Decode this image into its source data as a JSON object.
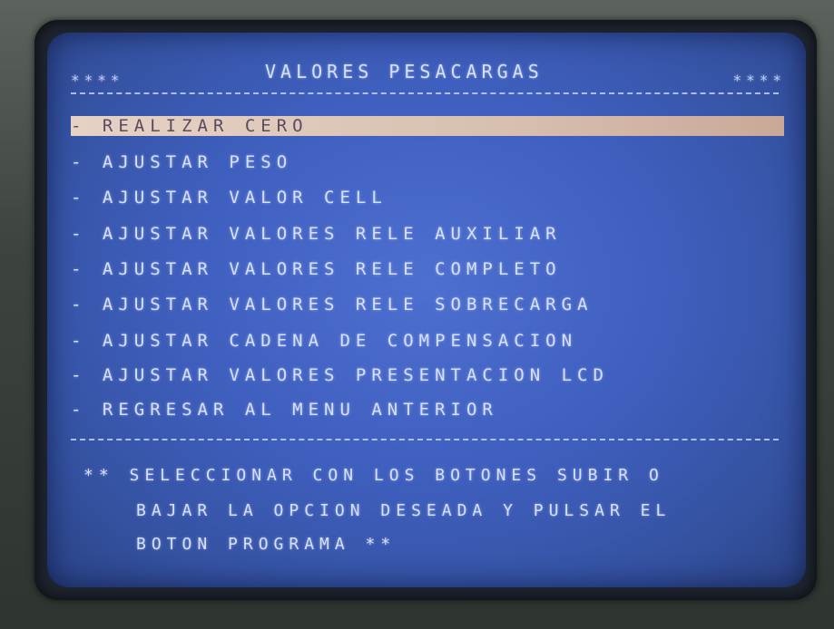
{
  "header": {
    "stars_left": "****",
    "title": "VALORES PESACARGAS",
    "stars_right": "****"
  },
  "menu": {
    "items": [
      {
        "label": "- REALIZAR CERO",
        "selected": true
      },
      {
        "label": "- AJUSTAR PESO",
        "selected": false
      },
      {
        "label": "- AJUSTAR VALOR CELL",
        "selected": false
      },
      {
        "label": "- AJUSTAR VALORES RELE AUXILIAR",
        "selected": false
      },
      {
        "label": "- AJUSTAR VALORES RELE COMPLETO",
        "selected": false
      },
      {
        "label": "- AJUSTAR VALORES RELE SOBRECARGA",
        "selected": false
      },
      {
        "label": "- AJUSTAR CADENA DE COMPENSACION",
        "selected": false
      },
      {
        "label": "- AJUSTAR VALORES PRESENTACION LCD",
        "selected": false
      },
      {
        "label": "- REGRESAR AL MENU ANTERIOR",
        "selected": false
      }
    ]
  },
  "footer": {
    "line1": "** SELECCIONAR CON LOS BOTONES SUBIR O",
    "line2": "BAJAR LA OPCION DESEADA Y PULSAR EL",
    "line3": "BOTON PROGRAMA **"
  },
  "colors": {
    "screen_blue": "#3f5fbf",
    "text": "#d6e0ff",
    "highlight": "#e6d2c4"
  }
}
